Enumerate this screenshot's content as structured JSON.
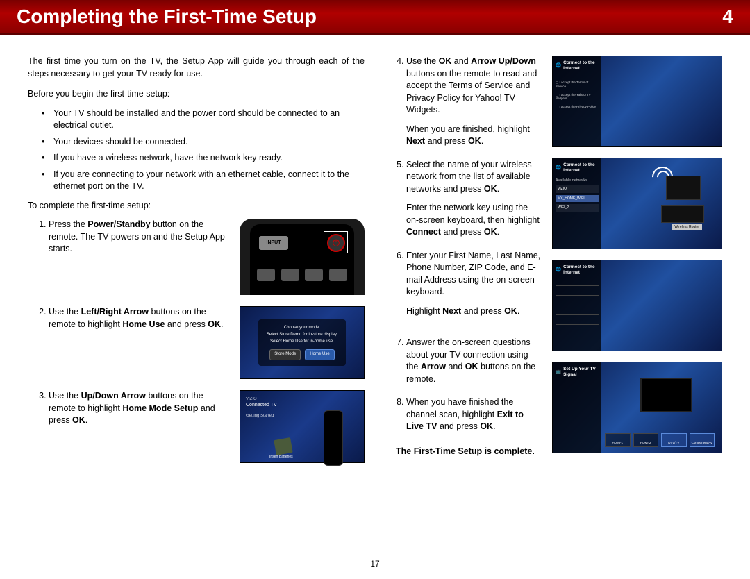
{
  "header": {
    "title": "Completing the First-Time Setup",
    "chapter": "4"
  },
  "left": {
    "intro": "The first time you turn on the TV, the Setup App will guide you through each of the steps necessary to get your TV ready for use.",
    "before_heading": "Before you begin the first-time setup:",
    "bullets": [
      "Your TV should be installed and the power cord should be connected to an electrical outlet.",
      "Your devices should be connected.",
      "If you have a wireless network, have the network key ready.",
      "If you are connecting to your network with an ethernet cable, connect it to the ethernet port on the TV."
    ],
    "complete_heading": "To complete the first-time setup:",
    "step1_a": "Press the ",
    "step1_bold": "Power/Standby",
    "step1_b": " button on the remote. The TV powers on and the Setup App starts.",
    "step2_a": "Use the ",
    "step2_bold1": "Left/Right Arrow",
    "step2_b": " buttons on the remote to highlight ",
    "step2_bold2": "Home Use",
    "step2_c": " and press ",
    "step2_bold3": "OK",
    "step2_d": ".",
    "step3_a": "Use the ",
    "step3_bold1": "Up/Down Arrow",
    "step3_b": " buttons on the remote to highlight ",
    "step3_bold2": "Home Mode Setup",
    "step3_c": " and press ",
    "step3_bold3": "OK",
    "step3_d": ".",
    "remote": {
      "input": "INPUT"
    },
    "mode_dialog": {
      "l1": "Choose your mode.",
      "l2": "Select Store Demo for in-store display.",
      "l3": "Select Home Use for in-home use.",
      "store": "Store Mode",
      "home": "Home Use"
    },
    "connected": {
      "brand": "VIZIO",
      "title": "Connected TV",
      "sub": "Getting Started",
      "insert": "Insert Batteries"
    }
  },
  "right": {
    "step4_a": "Use the ",
    "step4_bold1": "OK",
    "step4_b": " and ",
    "step4_bold2": "Arrow Up/Down",
    "step4_c": " buttons on the remote to read and accept the Terms of Service and Privacy Policy for Yahoo! TV Widgets.",
    "step4_p2a": "When you are finished, highlight ",
    "step4_p2bold": "Next",
    "step4_p2b": " and press ",
    "step4_p2bold2": "OK",
    "step4_p2c": ".",
    "step5_a": "Select the name of your wireless network from the list of available networks and press ",
    "step5_bold": "OK",
    "step5_b": ".",
    "step5_p2a": "Enter the network key using the on-screen keyboard, then highlight ",
    "step5_p2bold": "Connect",
    "step5_p2b": " and press ",
    "step5_p2bold2": "OK",
    "step5_p2c": ".",
    "step6_a": "Enter your First Name, Last Name, Phone Number, ZIP Code, and E-mail Address using the on-screen keyboard.",
    "step6_p2a": "Highlight ",
    "step6_p2bold": "Next",
    "step6_p2b": " and press ",
    "step6_p2bold2": "OK",
    "step6_p2c": ".",
    "step7_a": "Answer the on-screen questions about your TV connection using the ",
    "step7_bold1": "Arrow",
    "step7_b": " and ",
    "step7_bold2": "OK",
    "step7_c": " buttons on the remote.",
    "step8_a": "When you have finished the channel scan, highlight ",
    "step8_bold": "Exit to Live TV",
    "step8_b": " and press ",
    "step8_bold2": "OK",
    "step8_c": ".",
    "completion": "The First-Time Setup is complete.",
    "screens": {
      "connect_title": "Connect to the Internet",
      "tos_line1": "I accept the Terms of Service",
      "tos_line2": "I accept the Yahoo! TV Widgets",
      "tos_line3": "I accept the Privacy Policy",
      "avail": "Available networks",
      "net1": "VIZIO",
      "net2": "MY_HOME_WIFI",
      "net3": "WIFI_2",
      "router": "Wireless Router",
      "signal_title": "Set Up Your TV Signal",
      "sig1": "HDMI-1",
      "sig2": "HDMI-2",
      "sig3": "DTV/TV",
      "sig4": "Component/AV"
    }
  },
  "page_number": "17"
}
